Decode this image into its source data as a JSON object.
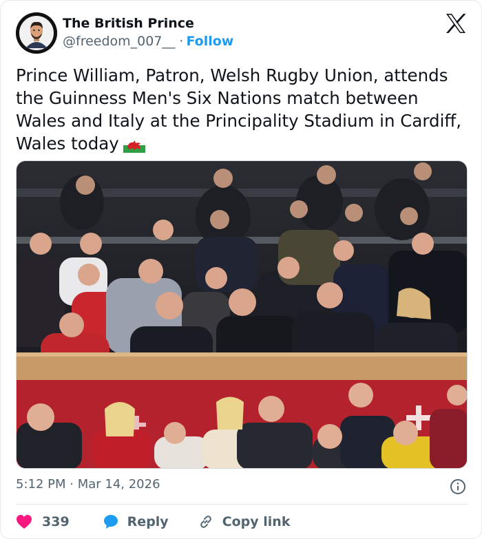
{
  "author": {
    "display_name": "The British Prince",
    "handle": "@freedom_007__",
    "separator": "·",
    "follow_label": "Follow",
    "avatar": "avatar-cartoon-man-icon"
  },
  "brand_icon": "x-logo-icon",
  "tweet": {
    "text": "Prince William, Patron, Welsh Rugby Union, attends the Guinness Men's Six Nations match between Wales and Italy at the Principality Stadium in Cardiff, Wales today",
    "emoji": "welsh-flag-icon"
  },
  "media": {
    "type": "photo",
    "subject": "crowd-in-stadium-stand"
  },
  "meta": {
    "timestamp": "5:12 PM · Mar 14, 2026",
    "info_icon": "info-icon"
  },
  "actions": {
    "like_count": "339",
    "reply_label": "Reply",
    "copy_link_label": "Copy link"
  },
  "colors": {
    "accent": "#1d9bf0",
    "like": "#f91880",
    "text_primary": "#0f1419",
    "text_secondary": "#536471"
  }
}
